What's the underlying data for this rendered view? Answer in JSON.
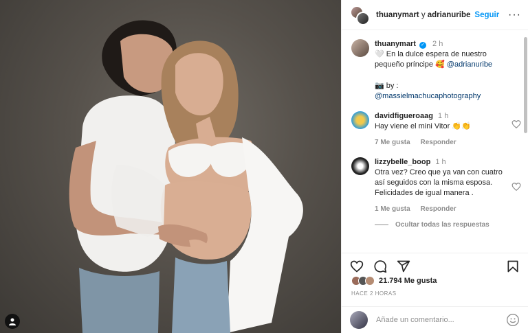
{
  "header": {
    "user1": "thuanymart",
    "joiner": " y ",
    "user2": "adrianuribe",
    "follow_label": "Seguir",
    "more_label": "···"
  },
  "caption": {
    "username": "thuanymart",
    "time": "2 h",
    "text": "🤍 En la dulce espera de nuestro pequeño príncipe 🥰",
    "mention": "@adrianuribe",
    "credit_prefix": "📷 by : ",
    "credit_mention": "@massielmachucaphotography"
  },
  "comments": [
    {
      "username": "davidfigueroaag",
      "time": "1 h",
      "text": "Hay viene el mini Vitor 👏👏",
      "likes": "7 Me gusta",
      "reply_label": "Responder"
    },
    {
      "username": "lizzybelle_boop",
      "time": "1 h",
      "text": "Otra vez? Creo que ya van con cuatro así seguidos con la misma esposa. Felicidades de igual manera .",
      "likes": "1 Me gusta",
      "reply_label": "Responder",
      "hide_replies": "Ocultar todas las respuestas"
    }
  ],
  "likes": {
    "count_label": "21.794 Me gusta"
  },
  "posted_ago": "HACE 2 HORAS",
  "add_comment": {
    "placeholder": "Añade un comentario..."
  },
  "colors": {
    "accent": "#0095f6",
    "muted": "#8e8e8e",
    "text": "#262626"
  },
  "icons": [
    "heart-icon",
    "comment-icon",
    "share-icon",
    "bookmark-icon",
    "emoji-icon",
    "tag-user-icon",
    "verified-icon"
  ]
}
